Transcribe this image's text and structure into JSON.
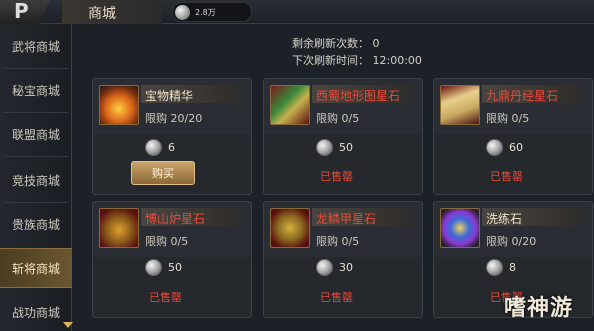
{
  "header": {
    "back_glyph": "P",
    "title": "商城",
    "currency": {
      "icon": "silver-coin-icon",
      "value": "2.8万"
    }
  },
  "sidebar": {
    "items": [
      {
        "label": "武将商城",
        "active": false
      },
      {
        "label": "秘宝商城",
        "active": false
      },
      {
        "label": "联盟商城",
        "active": false
      },
      {
        "label": "竞技商城",
        "active": false
      },
      {
        "label": "贵族商城",
        "active": false
      },
      {
        "label": "斩将商城",
        "active": true
      },
      {
        "label": "战功商城",
        "active": false
      }
    ]
  },
  "refresh": {
    "remaining": "剩余刷新次数： 0",
    "next_time": "下次刷新时间： 12:00:00"
  },
  "items": [
    {
      "name": "宝物精华",
      "name_color": "#f0e4c8",
      "limit": "限购 20/20",
      "price": "6",
      "status": "buy",
      "buy_label": "购买",
      "icon": "fire-essence-icon"
    },
    {
      "name": "西蜀地形图星石",
      "name_color": "#e84a3a",
      "limit": "限购 0/5",
      "price": "50",
      "status": "sold",
      "sold_label": "已售罄",
      "icon": "shu-map-star-stone-icon"
    },
    {
      "name": "九鼎丹经星石",
      "name_color": "#e84a3a",
      "limit": "限购 0/5",
      "price": "60",
      "status": "sold",
      "sold_label": "已售罄",
      "icon": "scroll-star-stone-icon"
    },
    {
      "name": "博山炉星石",
      "name_color": "#e84a3a",
      "limit": "限购 0/5",
      "price": "50",
      "status": "sold",
      "sold_label": "已售罄",
      "icon": "incense-burner-star-stone-icon"
    },
    {
      "name": "龙鳞甲星石",
      "name_color": "#e84a3a",
      "limit": "限购 0/5",
      "price": "30",
      "status": "sold",
      "sold_label": "已售罄",
      "icon": "dragon-armor-star-stone-icon"
    },
    {
      "name": "洗练石",
      "name_color": "#f0e4c8",
      "limit": "限购 0/20",
      "price": "8",
      "status": "sold",
      "sold_label": "已售罄",
      "icon": "refining-stone-icon"
    }
  ],
  "watermark": "嗜神游"
}
